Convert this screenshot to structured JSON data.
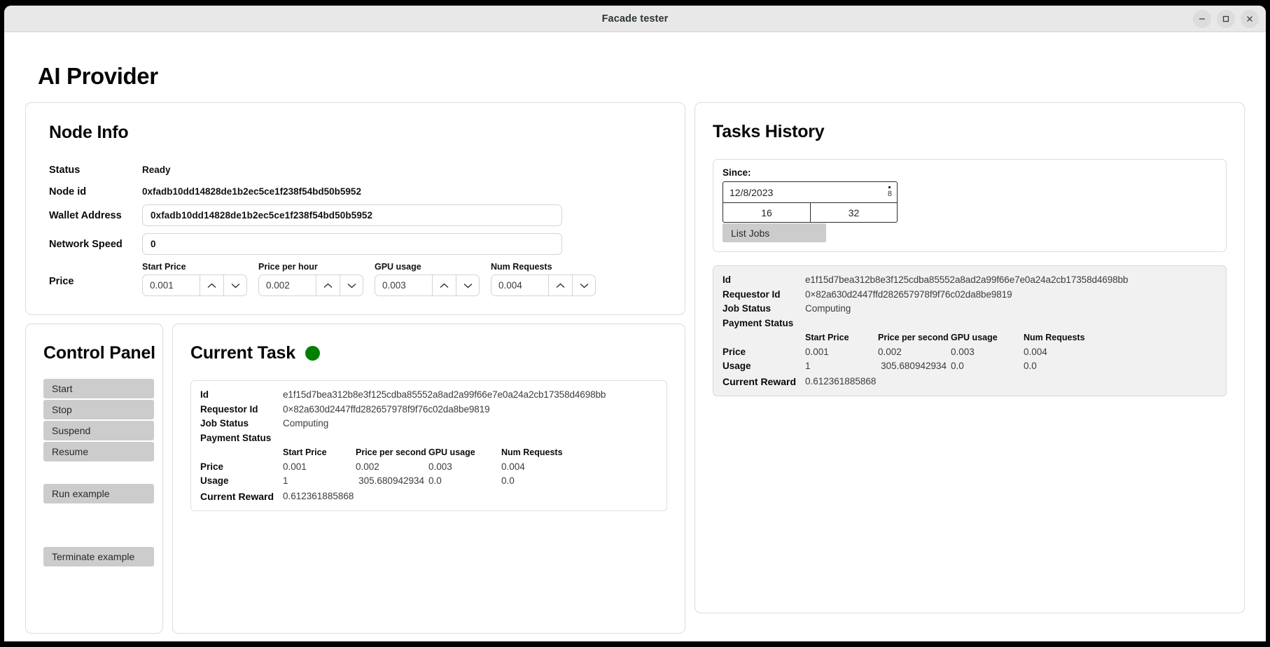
{
  "window": {
    "title": "Facade tester",
    "controls": [
      {
        "name": "minimize",
        "glyph": "minimize-icon"
      },
      {
        "name": "maximize",
        "glyph": "maximize-icon"
      },
      {
        "name": "close",
        "glyph": "close-icon"
      }
    ]
  },
  "app": {
    "title": "AI Provider"
  },
  "node_info": {
    "heading": "Node Info",
    "status_label": "Status",
    "status_value": "Ready",
    "node_id_label": "Node id",
    "node_id_value": "0xfadb10dd14828de1b2ec5ce1f238f54bd50b5952",
    "wallet_label": "Wallet Address",
    "wallet_value": "0xfadb10dd14828de1b2ec5ce1f238f54bd50b5952",
    "network_speed_label": "Network Speed",
    "network_speed_value": "0",
    "price_label": "Price",
    "spinners": [
      {
        "caption": "Start Price",
        "value": "0.001"
      },
      {
        "caption": "Price per hour",
        "value": "0.002"
      },
      {
        "caption": "GPU usage",
        "value": "0.003"
      },
      {
        "caption": "Num Requests",
        "value": "0.004"
      }
    ]
  },
  "control_panel": {
    "heading": "Control Panel",
    "buttons": [
      {
        "label": "Start"
      },
      {
        "label": "Stop"
      },
      {
        "label": "Suspend"
      },
      {
        "label": "Resume"
      },
      {
        "label": "Run example"
      },
      {
        "label": "Terminate example"
      }
    ]
  },
  "current_task": {
    "heading": "Current Task",
    "status_color": "#008000",
    "details": {
      "id_label": "Id",
      "id_value": "e1f15d7bea312b8e3f125cdba85552a8ad2a99f66e7e0a24a2cb17358d4698bb",
      "requestor_label": "Requestor Id",
      "requestor_value": "0×82a630d2447ffd282657978f9f76c02da8be9819",
      "job_status_label": "Job Status",
      "job_status_value": "Computing",
      "payment_status_label": "Payment Status",
      "payment_status_value": "",
      "columns": [
        "Start Price",
        "Price per second",
        "GPU usage",
        "Num Requests"
      ],
      "price_label": "Price",
      "price_values": [
        "0.001",
        "0.002",
        "0.003",
        "0.004"
      ],
      "usage_label": "Usage",
      "usage_values": [
        "1",
        "305.680942934",
        "0.0",
        "0.0"
      ],
      "reward_label": "Current Reward",
      "reward_value": "0.612361885868"
    }
  },
  "tasks_history": {
    "heading": "Tasks History",
    "since_label": "Since:",
    "date_value": "12/8/2023",
    "date_spinner_value": "8",
    "num_cells": [
      "16",
      "32"
    ],
    "list_jobs_label": "List Jobs",
    "result": {
      "id_label": "Id",
      "id_value": "e1f15d7bea312b8e3f125cdba85552a8ad2a99f66e7e0a24a2cb17358d4698bb",
      "requestor_label": "Requestor Id",
      "requestor_value": "0×82a630d2447ffd282657978f9f76c02da8be9819",
      "job_status_label": "Job Status",
      "job_status_value": "Computing",
      "payment_status_label": "Payment Status",
      "payment_status_value": "",
      "columns": [
        "Start Price",
        "Price per second",
        "GPU usage",
        "Num Requests"
      ],
      "price_label": "Price",
      "price_values": [
        "0.001",
        "0.002",
        "0.003",
        "0.004"
      ],
      "usage_label": "Usage",
      "usage_values": [
        "1",
        "305.680942934",
        "0.0",
        "0.0"
      ],
      "reward_label": "Current Reward",
      "reward_value": "0.612361885868"
    }
  }
}
